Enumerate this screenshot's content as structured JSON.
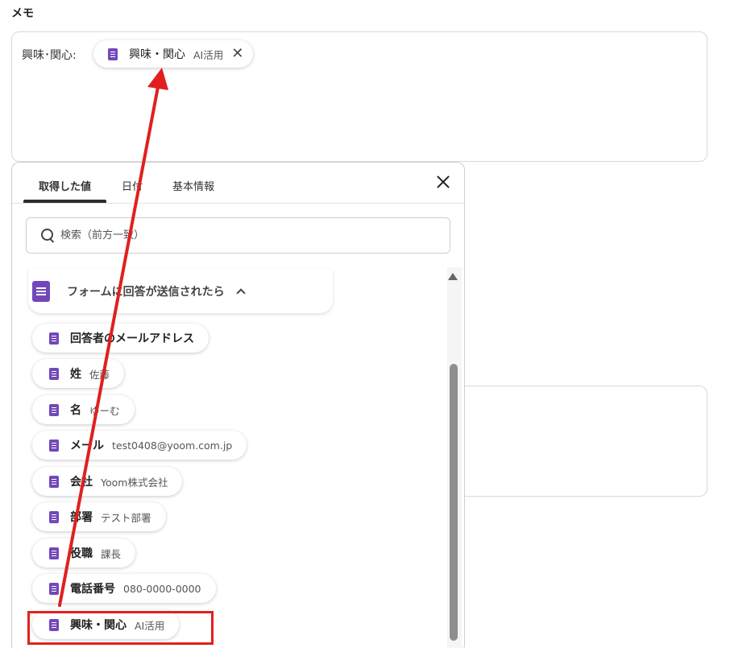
{
  "memo": {
    "label": "メモ",
    "prefix": "興味･関心:",
    "chip": {
      "label": "興味・関心",
      "sub": "AI活用",
      "close_glyph": "✕"
    }
  },
  "panel": {
    "tabs": [
      {
        "label": "取得した値",
        "active": true
      },
      {
        "label": "日付",
        "active": false
      },
      {
        "label": "基本情報",
        "active": false
      }
    ],
    "search_placeholder": "検索（前方一致）",
    "group": {
      "title": "フォームに回答が送信されたら",
      "expanded": true
    },
    "items": [
      {
        "label": "回答者のメールアドレス",
        "value": ""
      },
      {
        "label": "姓",
        "value": "佐藤"
      },
      {
        "label": "名",
        "value": "ゆーむ"
      },
      {
        "label": "メール",
        "value": "test0408@yoom.com.jp"
      },
      {
        "label": "会社",
        "value": "Yoom株式会社"
      },
      {
        "label": "部署",
        "value": "テスト部署"
      },
      {
        "label": "役職",
        "value": "課長"
      },
      {
        "label": "電話番号",
        "value": "080-0000-0000"
      },
      {
        "label": "興味・関心",
        "value": "AI活用"
      }
    ]
  },
  "annotation": {
    "color": "#e02020"
  },
  "colors": {
    "accent": "#7248b9"
  }
}
